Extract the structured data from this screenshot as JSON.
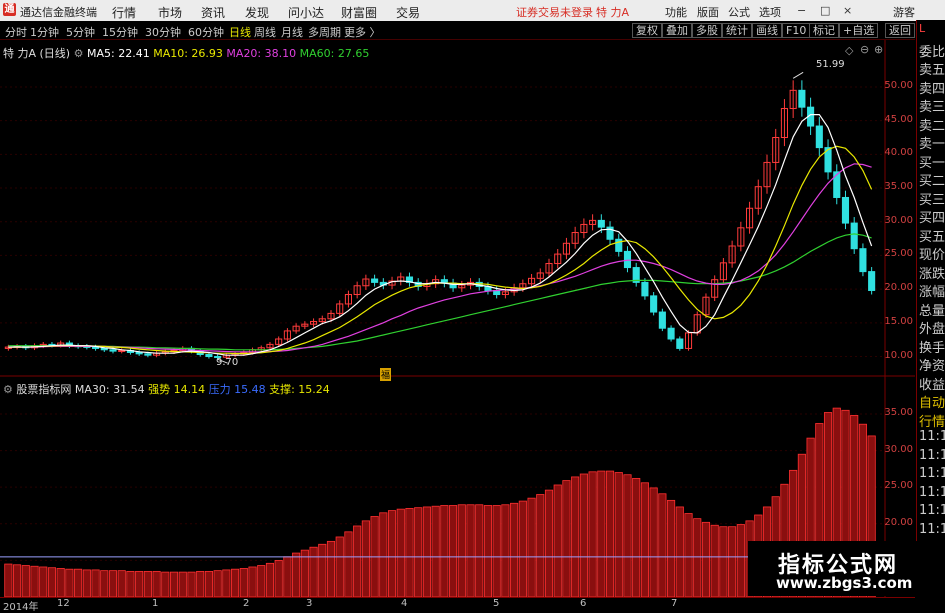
{
  "app": {
    "title": "通达信金融终端",
    "menu": [
      "行情",
      "市场",
      "资讯",
      "发现",
      "问小达",
      "财富圈",
      "交易"
    ],
    "login_warning": "证券交易未登录",
    "stock_name_top": "特 力A",
    "right_menu": [
      "功能",
      "版面",
      "公式",
      "选项"
    ],
    "guest_label": "游客",
    "window_controls": [
      "−",
      "□",
      "×"
    ]
  },
  "period_bar": {
    "periods": [
      "分时",
      "1分钟",
      "5分钟",
      "15分钟",
      "30分钟",
      "60分钟",
      "日线",
      "周线",
      "月线",
      "多周期",
      "更多 〉"
    ],
    "active_period": "日线",
    "tools": [
      "复权",
      "叠加",
      "多股",
      "统计",
      "画线",
      "F10",
      "标记",
      "+自选",
      "返回"
    ]
  },
  "main_legend": {
    "stock": "特 力A (日线)",
    "ma5": "MA5: 22.41",
    "ma10": "MA10: 26.93",
    "ma20": "MA20: 38.10",
    "ma60": "MA60: 27.65",
    "high_label": "51.99",
    "low_label": "9.70",
    "marker": "福",
    "colors": {
      "ma5": "#ffffff",
      "ma10": "#e8e800",
      "ma20": "#e040e0",
      "ma60": "#30d030",
      "up": "#ff3b3b",
      "down": "#30e0e0"
    }
  },
  "price_axis": [
    "50.00",
    "45.00",
    "40.00",
    "35.00",
    "30.00",
    "25.00",
    "20.00",
    "15.00",
    "10.00"
  ],
  "indicator_legend": {
    "name": "股票指标网",
    "ma30": "MA30: 31.54",
    "strong": "强势 14.14",
    "pressure": "压力 15.48",
    "support": "支撑: 15.24"
  },
  "indicator_axis": [
    "35.00",
    "30.00",
    "25.00",
    "20.00",
    "15.00"
  ],
  "sidebar_items": [
    "L",
    "委比",
    "卖五",
    "卖四",
    "卖三",
    "卖二",
    "卖一",
    "买一",
    "买二",
    "买三",
    "买四",
    "买五",
    "现价",
    "涨跌",
    "涨幅",
    "总量",
    "外盘",
    "换手",
    "净资",
    "收益",
    "自动",
    "行情",
    "11:1",
    "11:1",
    "11:1",
    "11:1",
    "11:1",
    "11:1",
    "11:1",
    "11:1"
  ],
  "date_axis": [
    "2014年",
    "12",
    "1",
    "2",
    "3",
    "4",
    "5",
    "6",
    "7"
  ],
  "watermark": {
    "line1": "指标公式网",
    "line2": "www.zbgs3.com"
  },
  "chart_data": {
    "type": "candlestick",
    "price_range": [
      8,
      54
    ],
    "indicator_range": [
      10,
      38
    ],
    "closes": [
      11.4,
      11.5,
      11.3,
      11.6,
      11.8,
      11.7,
      12.0,
      11.6,
      11.5,
      11.4,
      11.2,
      11.0,
      10.8,
      10.9,
      10.6,
      10.4,
      10.2,
      10.5,
      10.7,
      10.9,
      11.2,
      10.8,
      10.3,
      10.0,
      9.9,
      10.2,
      10.4,
      10.6,
      11.0,
      11.3,
      11.8,
      12.6,
      13.8,
      14.5,
      14.8,
      15.2,
      15.6,
      16.4,
      17.8,
      19.2,
      20.5,
      21.5,
      21.0,
      20.6,
      21.2,
      21.8,
      21.0,
      20.4,
      20.8,
      21.4,
      20.9,
      20.2,
      20.6,
      21.0,
      20.4,
      19.8,
      19.2,
      19.6,
      20.2,
      20.8,
      21.6,
      22.4,
      23.8,
      25.2,
      26.8,
      28.4,
      29.6,
      30.2,
      29.2,
      27.4,
      25.6,
      23.2,
      21.0,
      19.0,
      16.6,
      14.2,
      12.6,
      11.2,
      13.5,
      16.2,
      18.8,
      21.4,
      23.9,
      26.4,
      29.1,
      32.0,
      35.2,
      38.8,
      42.5,
      46.8,
      49.5,
      47.0,
      44.2,
      41.0,
      37.4,
      33.6,
      29.8,
      26.0,
      22.6,
      19.8
    ],
    "ma5": [
      11.4,
      11.45,
      11.4,
      11.45,
      11.5,
      11.6,
      11.7,
      11.7,
      11.6,
      11.6,
      11.5,
      11.3,
      11.2,
      11.0,
      10.9,
      10.7,
      10.6,
      10.5,
      10.5,
      10.5,
      10.7,
      10.8,
      10.7,
      10.6,
      10.4,
      10.2,
      10.2,
      10.2,
      10.4,
      10.7,
      11.0,
      11.5,
      12.1,
      12.8,
      13.5,
      14.2,
      14.9,
      15.3,
      15.9,
      16.8,
      17.9,
      19.1,
      20.0,
      20.6,
      21.1,
      21.2,
      21.1,
      20.8,
      20.8,
      21.0,
      20.9,
      20.7,
      20.7,
      20.8,
      20.6,
      20.4,
      20.1,
      19.9,
      19.8,
      19.9,
      20.3,
      20.9,
      21.8,
      22.9,
      24.0,
      25.3,
      26.8,
      28.0,
      28.8,
      28.9,
      28.5,
      27.1,
      25.3,
      23.2,
      21.1,
      18.8,
      16.7,
      14.7,
      13.6,
      13.5,
      14.5,
      16.2,
      18.8,
      21.3,
      23.9,
      26.6,
      29.3,
      32.3,
      35.5,
      39.1,
      42.6,
      44.9,
      45.9,
      45.9,
      44.0,
      40.6,
      36.8,
      33.6,
      29.9,
      26.4
    ],
    "ma10": [
      11.4,
      11.4,
      11.4,
      11.45,
      11.5,
      11.55,
      11.6,
      11.6,
      11.6,
      11.6,
      11.55,
      11.5,
      11.4,
      11.35,
      11.25,
      11.1,
      11.0,
      10.9,
      10.8,
      10.75,
      10.7,
      10.65,
      10.6,
      10.55,
      10.5,
      10.5,
      10.45,
      10.45,
      10.5,
      10.55,
      10.7,
      10.9,
      11.2,
      11.6,
      12.0,
      12.5,
      13.1,
      13.7,
      14.3,
      15.1,
      15.9,
      16.8,
      17.7,
      18.4,
      19.1,
      19.7,
      20.2,
      20.5,
      20.7,
      20.9,
      20.9,
      20.9,
      20.8,
      20.8,
      20.8,
      20.7,
      20.5,
      20.3,
      20.2,
      20.1,
      20.2,
      20.4,
      20.8,
      21.4,
      22.1,
      22.9,
      23.8,
      24.9,
      25.8,
      26.6,
      27.0,
      27.2,
      26.9,
      26.0,
      24.8,
      23.3,
      21.7,
      20.0,
      18.4,
      17.0,
      16.0,
      15.6,
      15.8,
      16.5,
      17.6,
      19.2,
      21.2,
      23.6,
      26.4,
      29.4,
      32.6,
      35.4,
      37.8,
      39.6,
      40.7,
      41.2,
      40.9,
      39.6,
      37.6,
      34.8
    ],
    "ma20": [
      11.4,
      11.4,
      11.4,
      11.4,
      11.45,
      11.5,
      11.5,
      11.5,
      11.5,
      11.5,
      11.5,
      11.5,
      11.45,
      11.4,
      11.35,
      11.3,
      11.2,
      11.15,
      11.1,
      11.05,
      11.0,
      10.95,
      10.9,
      10.85,
      10.8,
      10.75,
      10.7,
      10.7,
      10.7,
      10.7,
      10.75,
      10.8,
      10.9,
      11.1,
      11.3,
      11.5,
      11.8,
      12.2,
      12.6,
      13.0,
      13.5,
      14.0,
      14.5,
      15.0,
      15.6,
      16.1,
      16.7,
      17.2,
      17.6,
      18.0,
      18.4,
      18.7,
      19.0,
      19.3,
      19.5,
      19.7,
      19.8,
      19.9,
      20.0,
      20.1,
      20.3,
      20.5,
      20.8,
      21.1,
      21.5,
      21.9,
      22.4,
      22.9,
      23.4,
      23.8,
      24.1,
      24.3,
      24.3,
      24.1,
      23.8,
      23.4,
      22.9,
      22.3,
      21.7,
      21.2,
      20.9,
      20.7,
      20.7,
      20.9,
      21.3,
      21.9,
      22.7,
      23.8,
      25.1,
      26.7,
      28.5,
      30.4,
      32.3,
      34.1,
      35.7,
      37.0,
      38.0,
      38.6,
      38.5,
      38.1
    ],
    "ma60": [
      11.6,
      11.6,
      11.6,
      11.6,
      11.6,
      11.6,
      11.6,
      11.6,
      11.6,
      11.55,
      11.5,
      11.5,
      11.5,
      11.45,
      11.4,
      11.4,
      11.35,
      11.3,
      11.3,
      11.25,
      11.2,
      11.2,
      11.15,
      11.1,
      11.1,
      11.05,
      11.0,
      11.0,
      11.0,
      11.0,
      11.0,
      11.05,
      11.1,
      11.2,
      11.3,
      11.4,
      11.5,
      11.7,
      11.9,
      12.1,
      12.3,
      12.6,
      12.9,
      13.2,
      13.5,
      13.8,
      14.1,
      14.4,
      14.7,
      15.0,
      15.3,
      15.6,
      15.9,
      16.2,
      16.5,
      16.8,
      17.1,
      17.4,
      17.7,
      18.0,
      18.3,
      18.6,
      18.9,
      19.2,
      19.5,
      19.8,
      20.1,
      20.4,
      20.7,
      20.9,
      21.1,
      21.2,
      21.3,
      21.3,
      21.3,
      21.2,
      21.1,
      21.0,
      20.9,
      20.8,
      20.8,
      20.8,
      20.9,
      21.0,
      21.2,
      21.5,
      21.8,
      22.2,
      22.7,
      23.3,
      24.0,
      24.8,
      25.6,
      26.3,
      27.0,
      27.6,
      28.0,
      28.2,
      28.0,
      27.6
    ],
    "indicator": [
      14.5,
      14.4,
      14.3,
      14.2,
      14.1,
      14.0,
      13.9,
      13.8,
      13.8,
      13.7,
      13.7,
      13.6,
      13.6,
      13.6,
      13.5,
      13.5,
      13.5,
      13.5,
      13.4,
      13.4,
      13.4,
      13.4,
      13.5,
      13.5,
      13.6,
      13.7,
      13.8,
      13.9,
      14.1,
      14.3,
      14.6,
      15.0,
      15.5,
      16.0,
      16.4,
      16.8,
      17.2,
      17.6,
      18.2,
      18.9,
      19.7,
      20.4,
      21.0,
      21.5,
      21.8,
      22.0,
      22.1,
      22.2,
      22.3,
      22.4,
      22.5,
      22.5,
      22.6,
      22.6,
      22.6,
      22.5,
      22.5,
      22.6,
      22.8,
      23.1,
      23.5,
      24.0,
      24.6,
      25.3,
      25.9,
      26.4,
      26.8,
      27.1,
      27.2,
      27.2,
      27.0,
      26.7,
      26.2,
      25.6,
      24.9,
      24.1,
      23.2,
      22.3,
      21.4,
      20.7,
      20.2,
      19.8,
      19.6,
      19.6,
      19.9,
      20.4,
      21.2,
      22.3,
      23.7,
      25.4,
      27.3,
      29.5,
      31.7,
      33.7,
      35.2,
      35.8,
      35.5,
      34.8,
      33.6,
      32.0
    ],
    "pressure_line": 15.48
  }
}
